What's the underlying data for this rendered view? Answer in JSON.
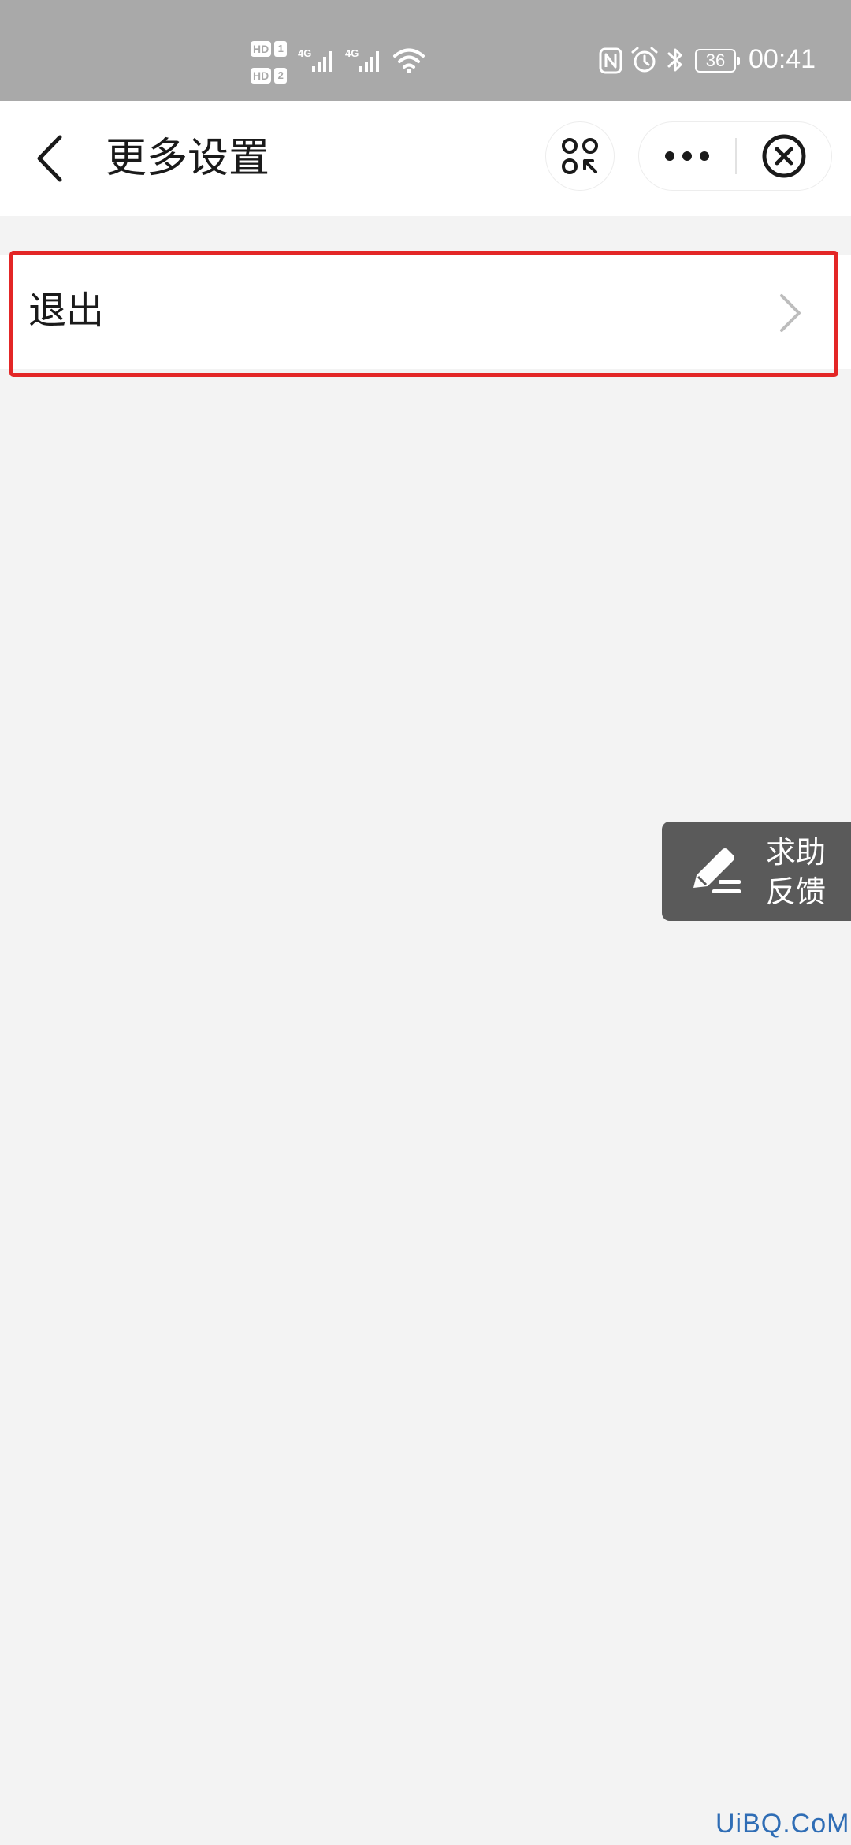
{
  "status_bar": {
    "sim1_badge": "HD",
    "sim1_number": "1",
    "sim2_badge": "HD",
    "sim2_number": "2",
    "network1": "4G",
    "network2": "4G",
    "battery": "36",
    "time": "00:41",
    "icons": [
      "nfc-icon",
      "alarm-icon",
      "bluetooth-icon",
      "wifi-icon"
    ]
  },
  "nav": {
    "title": "更多设置",
    "back_icon": "chevron-left-icon",
    "scan_icon": "scan-icon",
    "more_icon": "more-dots-icon",
    "close_icon": "close-circle-icon"
  },
  "list": {
    "items": [
      {
        "label": "退出",
        "icon": "chevron-right-icon"
      }
    ]
  },
  "feedback": {
    "line1": "求助",
    "line2": "反馈",
    "icon": "pencil-icon"
  },
  "watermark": "UiBQ.CoM",
  "colors": {
    "status_bar": "#a9a9a9",
    "page_background": "#f3f3f3",
    "highlight_border": "#e32626",
    "feedback_background": "#5a5a5a",
    "watermark": "#2f6db5"
  }
}
